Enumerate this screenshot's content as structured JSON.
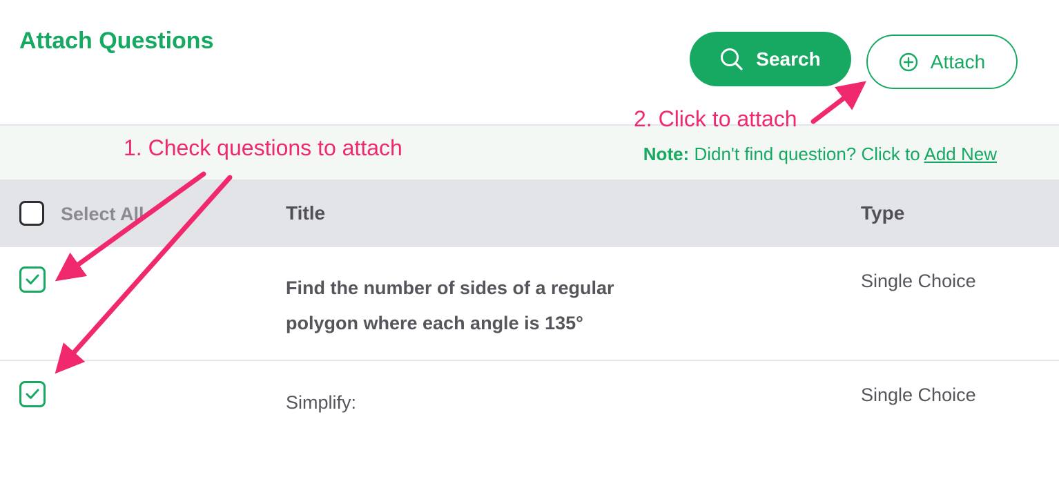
{
  "header": {
    "title": "Attach Questions",
    "search_button": "Search",
    "attach_button": "Attach"
  },
  "note": {
    "label": "Note:",
    "text": "Didn't find question? Click to",
    "link": "Add New"
  },
  "table": {
    "select_all": "Select All",
    "columns": [
      "Title",
      "Type"
    ],
    "rows": [
      {
        "checked": true,
        "title": "Find the number of sides of a regular polygon where each angle is 135°",
        "type": "Single Choice"
      },
      {
        "checked": true,
        "title": "Simplify:",
        "type": "Single Choice"
      }
    ]
  },
  "annotations": {
    "step1": "1. Check questions to attach",
    "step2": "2. Click to attach"
  },
  "colors": {
    "brand": "#17a862",
    "annotation": "#f0286e",
    "header_bg": "#e3e4e8",
    "note_bg": "#f3f8f5"
  },
  "icons": {
    "search": "search-icon",
    "attach": "plus-circle-icon",
    "check": "check-icon"
  }
}
